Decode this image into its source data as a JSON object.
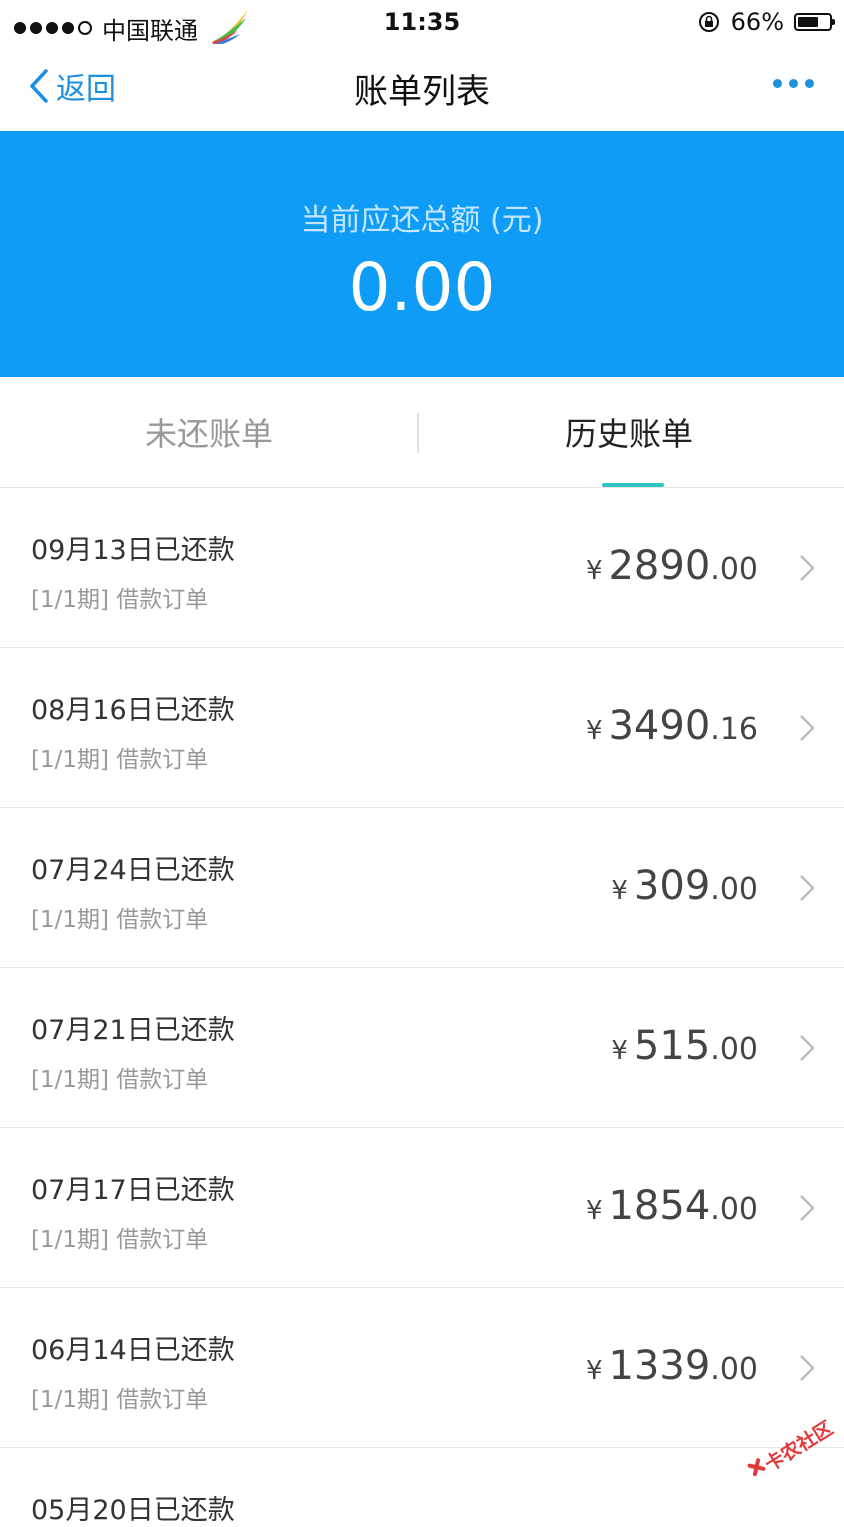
{
  "status_bar": {
    "carrier": "中国联通",
    "time": "11:35",
    "battery": "66%",
    "battery_level": 0.66
  },
  "nav": {
    "back_label": "返回",
    "title": "账单列表"
  },
  "banner": {
    "label": "当前应还总额 (元)",
    "amount": "0.00"
  },
  "tabs": [
    {
      "label": "未还账单",
      "active": false
    },
    {
      "label": "历史账单",
      "active": true
    }
  ],
  "bills": [
    {
      "title": "09月13日已还款",
      "subtitle": "[1/1期] 借款订单",
      "currency": "¥",
      "amount_int": "2890",
      "amount_dec": ".00"
    },
    {
      "title": "08月16日已还款",
      "subtitle": "[1/1期] 借款订单",
      "currency": "¥",
      "amount_int": "3490",
      "amount_dec": ".16"
    },
    {
      "title": "07月24日已还款",
      "subtitle": "[1/1期] 借款订单",
      "currency": "¥",
      "amount_int": "309",
      "amount_dec": ".00"
    },
    {
      "title": "07月21日已还款",
      "subtitle": "[1/1期] 借款订单",
      "currency": "¥",
      "amount_int": "515",
      "amount_dec": ".00"
    },
    {
      "title": "07月17日已还款",
      "subtitle": "[1/1期] 借款订单",
      "currency": "¥",
      "amount_int": "1854",
      "amount_dec": ".00"
    },
    {
      "title": "06月14日已还款",
      "subtitle": "[1/1期] 借款订单",
      "currency": "¥",
      "amount_int": "1339",
      "amount_dec": ".00"
    }
  ],
  "partial_item": {
    "title": "05月20日已还款"
  },
  "watermark": {
    "text": "卡农社区"
  },
  "colors": {
    "accent": "#1d8fe0",
    "banner": "#0f9cf7",
    "tab_indicator": "#2fc6c0"
  }
}
